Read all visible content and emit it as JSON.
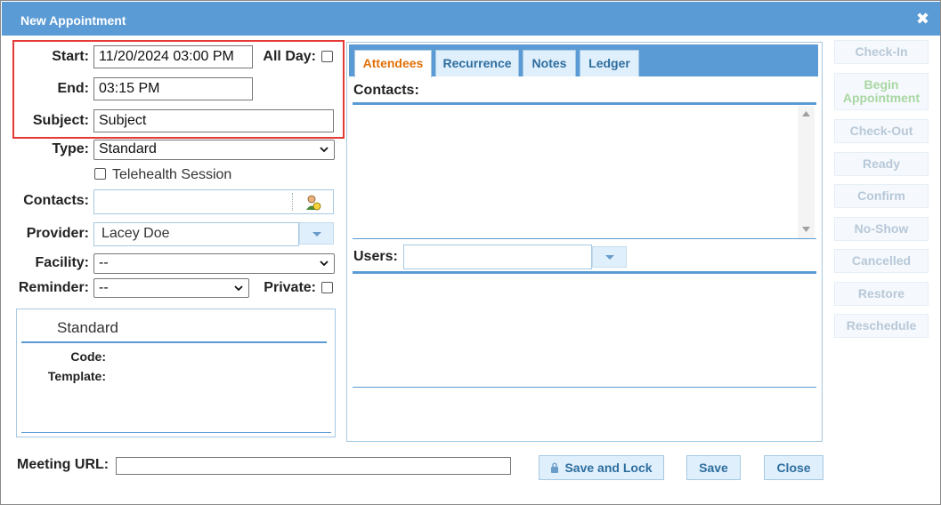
{
  "dialog": {
    "title": "New Appointment",
    "close_icon": "close-icon"
  },
  "form": {
    "start_label": "Start:",
    "start_value": "11/20/2024 03:00 PM",
    "allday_label": "All Day:",
    "allday_checked": false,
    "end_label": "End:",
    "end_value": "03:15 PM",
    "subject_label": "Subject:",
    "subject_value": "Subject",
    "type_label": "Type:",
    "type_value": "Standard",
    "telehealth_label": "Telehealth Session",
    "contacts_label": "Contacts:",
    "contacts_value": "",
    "contact_picker_icon": "person-search-icon",
    "provider_label": "Provider:",
    "provider_value": "Lacey Doe",
    "facility_label": "Facility:",
    "facility_value": "--",
    "reminder_label": "Reminder:",
    "reminder_value": "--",
    "private_label": "Private:",
    "meeting_url_label": "Meeting URL:",
    "meeting_url_value": ""
  },
  "type_panel": {
    "title": "Standard",
    "code_label": "Code:",
    "template_label": "Template:"
  },
  "tabs": [
    {
      "label": "Attendees",
      "active": true
    },
    {
      "label": "Recurrence",
      "active": false
    },
    {
      "label": "Notes",
      "active": false
    },
    {
      "label": "Ledger",
      "active": false
    }
  ],
  "attendees": {
    "contacts_heading": "Contacts:",
    "users_label": "Users:",
    "users_value": ""
  },
  "side_actions": [
    "Check-In",
    "Begin Appointment",
    "Check-Out",
    "Ready",
    "Confirm",
    "No-Show",
    "Cancelled",
    "Restore",
    "Reschedule"
  ],
  "footer": {
    "save_lock_label": "Save and Lock",
    "lock_icon": "lock-icon",
    "save_label": "Save",
    "close_label": "Close"
  },
  "colors": {
    "titlebar": "#5b9bd5",
    "highlight_border": "#e53935",
    "active_tab_text": "#e17009",
    "tab_text": "#2e6e9e"
  }
}
